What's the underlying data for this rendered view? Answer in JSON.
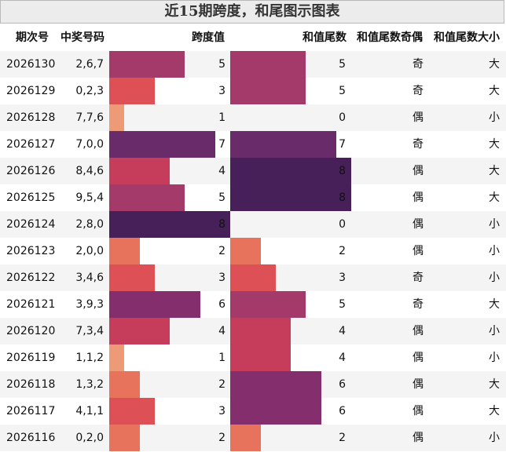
{
  "title": "近15期跨度，和尾图示图表",
  "headers": {
    "period": "期次号",
    "numbers": "中奖号码",
    "span": "跨度值",
    "sum_tail": "和值尾数",
    "parity": "和值尾数奇偶",
    "size": "和值尾数大小"
  },
  "rows": [
    {
      "period": "2026130",
      "numbers": "2,6,7",
      "span": 5,
      "sum_tail": 5,
      "parity": "奇",
      "size": "大"
    },
    {
      "period": "2026129",
      "numbers": "0,2,3",
      "span": 3,
      "sum_tail": 5,
      "parity": "奇",
      "size": "大"
    },
    {
      "period": "2026128",
      "numbers": "7,7,6",
      "span": 1,
      "sum_tail": 0,
      "parity": "偶",
      "size": "小"
    },
    {
      "period": "2026127",
      "numbers": "7,0,0",
      "span": 7,
      "sum_tail": 7,
      "parity": "奇",
      "size": "大"
    },
    {
      "period": "2026126",
      "numbers": "8,4,6",
      "span": 4,
      "sum_tail": 8,
      "parity": "偶",
      "size": "大"
    },
    {
      "period": "2026125",
      "numbers": "9,5,4",
      "span": 5,
      "sum_tail": 8,
      "parity": "偶",
      "size": "大"
    },
    {
      "period": "2026124",
      "numbers": "2,8,0",
      "span": 8,
      "sum_tail": 0,
      "parity": "偶",
      "size": "小"
    },
    {
      "period": "2026123",
      "numbers": "2,0,0",
      "span": 2,
      "sum_tail": 2,
      "parity": "偶",
      "size": "小"
    },
    {
      "period": "2026122",
      "numbers": "3,4,6",
      "span": 3,
      "sum_tail": 3,
      "parity": "奇",
      "size": "小"
    },
    {
      "period": "2026121",
      "numbers": "3,9,3",
      "span": 6,
      "sum_tail": 5,
      "parity": "奇",
      "size": "大"
    },
    {
      "period": "2026120",
      "numbers": "7,3,4",
      "span": 4,
      "sum_tail": 4,
      "parity": "偶",
      "size": "小"
    },
    {
      "period": "2026119",
      "numbers": "1,1,2",
      "span": 1,
      "sum_tail": 4,
      "parity": "偶",
      "size": "小"
    },
    {
      "period": "2026118",
      "numbers": "1,3,2",
      "span": 2,
      "sum_tail": 6,
      "parity": "偶",
      "size": "大"
    },
    {
      "period": "2026117",
      "numbers": "4,1,1",
      "span": 3,
      "sum_tail": 6,
      "parity": "偶",
      "size": "大"
    },
    {
      "period": "2026116",
      "numbers": "0,2,0",
      "span": 2,
      "sum_tail": 2,
      "parity": "偶",
      "size": "小"
    }
  ],
  "chart_data": {
    "type": "table",
    "title": "近15期跨度，和尾图示图表",
    "columns": [
      "期次号",
      "中奖号码",
      "跨度值",
      "和值尾数",
      "和值尾数奇偶",
      "和值尾数大小"
    ],
    "series": [
      {
        "name": "跨度值",
        "values": [
          5,
          3,
          1,
          7,
          4,
          5,
          8,
          2,
          3,
          6,
          4,
          1,
          2,
          3,
          2
        ]
      },
      {
        "name": "和值尾数",
        "values": [
          5,
          5,
          0,
          7,
          8,
          8,
          0,
          2,
          3,
          5,
          4,
          4,
          6,
          6,
          2
        ]
      }
    ],
    "x": [
      "2026130",
      "2026129",
      "2026128",
      "2026127",
      "2026126",
      "2026125",
      "2026124",
      "2026123",
      "2026122",
      "2026121",
      "2026120",
      "2026119",
      "2026118",
      "2026117",
      "2026116"
    ],
    "colors": {
      "1": "#ee9a77",
      "2": "#e8735c",
      "3": "#dd5156",
      "4": "#c63d5b",
      "5": "#a33a6a",
      "6": "#842e6e",
      "7": "#692b69",
      "8": "#47205a"
    },
    "bar_max": 8
  }
}
